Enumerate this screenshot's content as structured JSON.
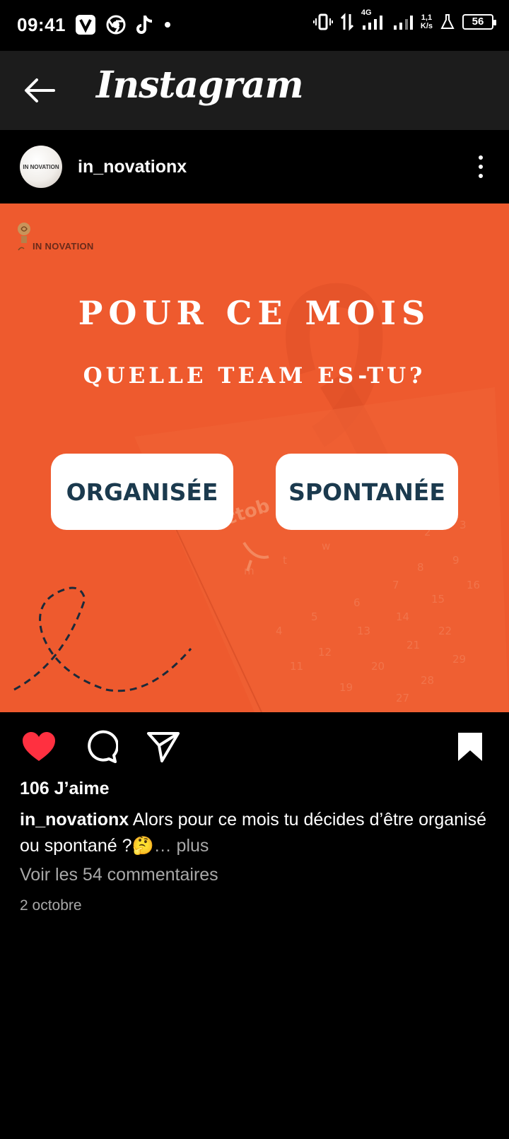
{
  "status_bar": {
    "time": "09:41",
    "network": "4G",
    "speed_value": "1,1",
    "speed_unit": "K/s",
    "battery": "56"
  },
  "app_bar": {
    "title": "Instagram",
    "back_icon": "arrow-left-icon"
  },
  "post": {
    "avatar_text": "IN NOVATION",
    "username": "in_novationx",
    "image": {
      "brand": "IN NOVATION",
      "headline1": "POUR CE MOIS",
      "headline2": "QUELLE TEAM ES-TU?",
      "choice1": "ORGANISÉE",
      "choice2": "SPONTANÉE",
      "calendar_word": "octob",
      "background_color": "#ee5a2e"
    },
    "liked": true,
    "like_color": "#ff3040",
    "likes": "106 J’aime",
    "caption_user": "in_novationx",
    "caption_text": " Alors pour ce mois tu décides d’être organisé ou spontané ?🤔",
    "caption_more": "… plus",
    "comments_link": "Voir les 54 commentaires",
    "date": "2 octobre"
  }
}
